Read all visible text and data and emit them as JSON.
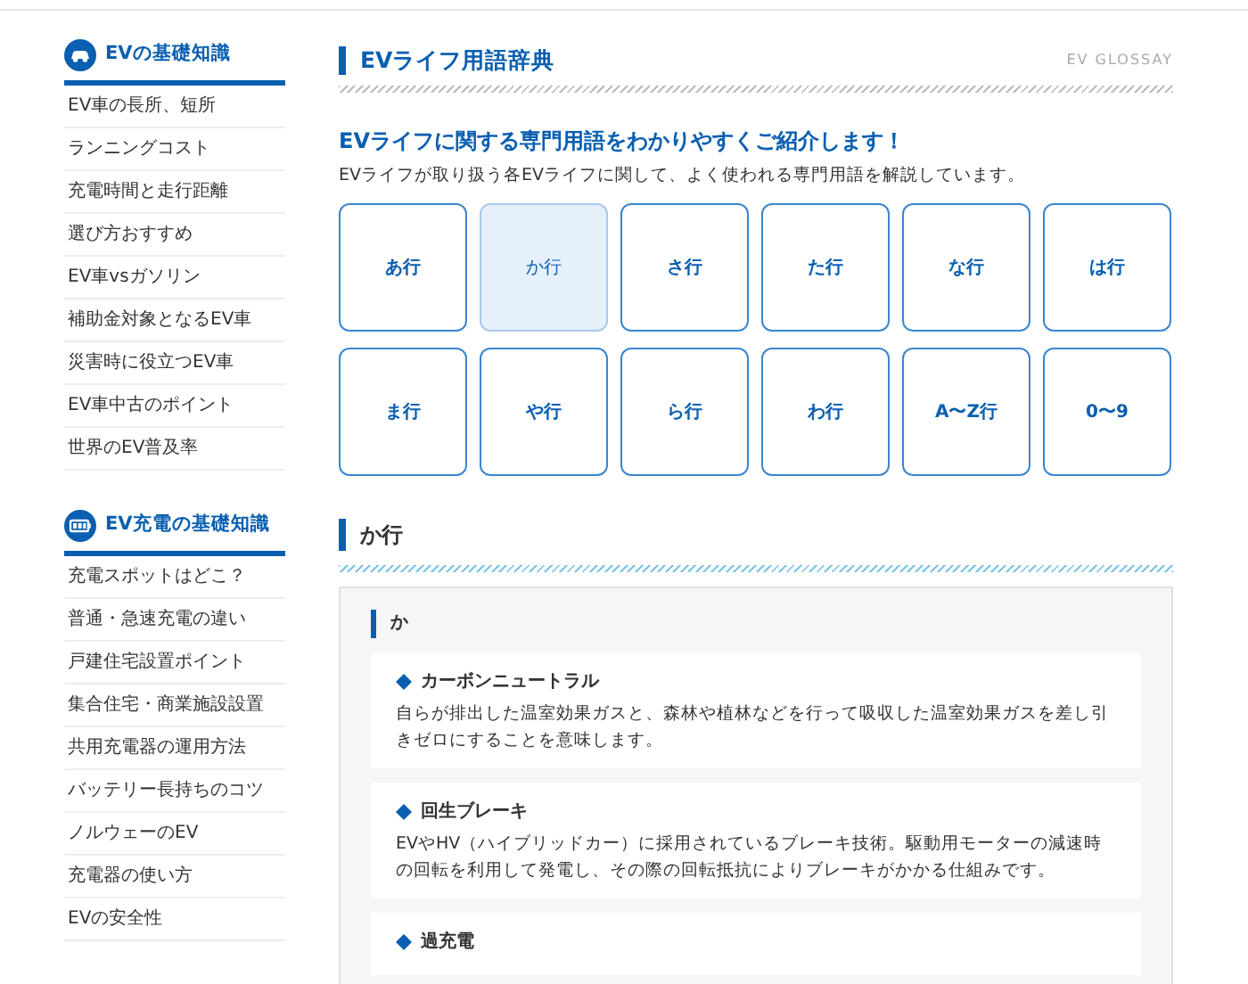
{
  "sidebar": [
    {
      "title": "EVの基礎知識",
      "items": [
        "EV車の長所、短所",
        "ランニングコスト",
        "充電時間と走行距離",
        "選び方おすすめ",
        "EV車vsガソリン",
        "補助金対象となるEV車",
        "災害時に役立つEV車",
        "EV車中古のポイント",
        "世界のEV普及率"
      ]
    },
    {
      "title": "EV充電の基礎知識",
      "items": [
        "充電スポットはどこ？",
        "普通・急速充電の違い",
        "戸建住宅設置ポイント",
        "集合住宅・商業施設設置",
        "共用充電器の運用方法",
        "バッテリー長持ちのコツ",
        "ノルウェーのEV",
        "充電器の使い方",
        "EVの安全性"
      ]
    }
  ],
  "main": {
    "title": "EVライフ用語辞典",
    "title_en": "EV GLOSSAY",
    "lead": "EVライフに関する専門用語をわかりやすくご紹介します！",
    "description": "EVライフが取り扱う各EVライフに関して、よく使われる専門用語を解説しています。",
    "index_buttons": [
      {
        "label": "あ行",
        "selected": false
      },
      {
        "label": "か行",
        "selected": true
      },
      {
        "label": "さ行",
        "selected": false
      },
      {
        "label": "た行",
        "selected": false
      },
      {
        "label": "な行",
        "selected": false
      },
      {
        "label": "は行",
        "selected": false
      },
      {
        "label": "ま行",
        "selected": false
      },
      {
        "label": "や行",
        "selected": false
      },
      {
        "label": "ら行",
        "selected": false
      },
      {
        "label": "わ行",
        "selected": false
      },
      {
        "label": "A〜Z行",
        "selected": false
      },
      {
        "label": "0〜9",
        "selected": false
      }
    ],
    "section": {
      "title": "か行",
      "groups": [
        {
          "heading": "か",
          "terms": [
            {
              "term": "カーボンニュートラル",
              "definition": "自らが排出した温室効果ガスと、森林や植林などを行って吸収した温室効果ガスを差し引きゼロにすることを意味します。"
            },
            {
              "term": "回生ブレーキ",
              "definition": "EVやHV（ハイブリッドカー）に採用されているブレーキ技術。駆動用モーターの減速時の回転を利用して発電し、その際の回転抵抗によりブレーキがかかる仕組みです。"
            },
            {
              "term": "過充電"
            }
          ]
        }
      ]
    }
  }
}
